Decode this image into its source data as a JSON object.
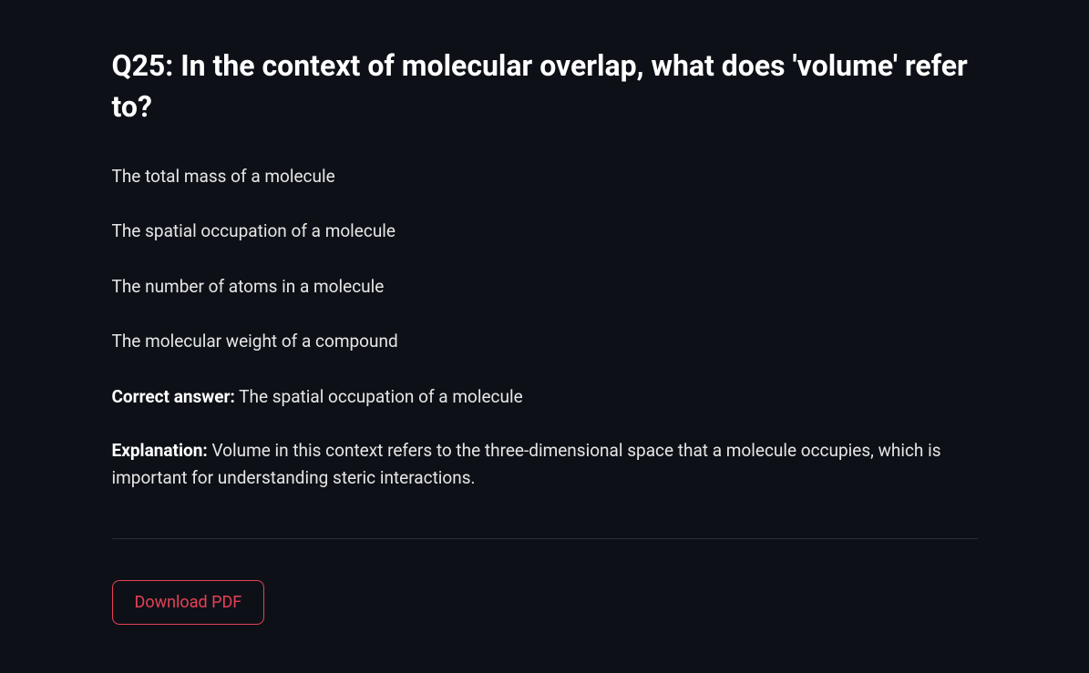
{
  "question": {
    "title": "Q25: In the context of molecular overlap, what does 'volume' refer to?",
    "options": [
      "The total mass of a molecule",
      "The spatial occupation of a molecule",
      "The number of atoms in a molecule",
      "The molecular weight of a compound"
    ],
    "correct_label": "Correct answer:",
    "correct_answer": "The spatial occupation of a molecule",
    "explanation_label": "Explanation:",
    "explanation_text": "Volume in this context refers to the three-dimensional space that a molecule occupies, which is important for understanding steric interactions."
  },
  "actions": {
    "download_label": "Download PDF"
  }
}
